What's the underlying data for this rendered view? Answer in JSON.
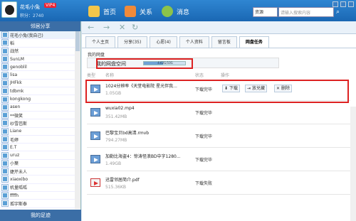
{
  "header": {
    "username": "花毛小兔",
    "vip_badge": "VIP4",
    "score": "积分：2740",
    "nav": [
      "首页",
      "关系",
      "消息"
    ],
    "search_select": "资源",
    "search_placeholder": "请输入搜索内容"
  },
  "sidebar": {
    "title": "邻居分享",
    "items": [
      "花毛小兔(我自己)",
      "稻",
      "战然",
      "SunLM",
      "genoblil",
      "lisa",
      "JHFkk",
      "tdbmk",
      "kongkong",
      "asen",
      "**微笑",
      "纱雪芭斯",
      "Liane",
      "毛婷",
      "E.T",
      "uruz",
      "小葉",
      "婕芹未人",
      "xiaoxibo",
      "机量呱呱",
      "ffffh",
      "孤宇斯泰"
    ],
    "footer": "我的足迹"
  },
  "tabs": [
    "个人主页",
    "分享(35)",
    "心愿(4)",
    "个人资料",
    "留言板",
    "网盘任务"
  ],
  "active_tab": "网盘任务",
  "section_title": "我的网盘",
  "space": {
    "label": "我的网盘空间",
    "usage": "4.62G/10G",
    "fraction": 0.46
  },
  "columns": [
    "类型",
    "名称",
    "状态",
    "操作"
  ],
  "files": [
    {
      "name": "1024分辨率《天堂电影院 星光伴我...",
      "size": "1.05GB",
      "status": "下载完毕",
      "type": "video"
    },
    {
      "name": "wuxia02.mp4",
      "size": "351.42MB",
      "status": "下载完毕",
      "type": "video"
    },
    {
      "name": "巴黎宝贝bd高清.rmvb",
      "size": "794.27MB",
      "status": "下载完毕",
      "type": "video"
    },
    {
      "name": "加勒比海盗4：惊涛怪浪BD中字1280...",
      "size": "1.49GB",
      "status": "下载完毕",
      "type": "video"
    },
    {
      "name": "迅雷邻居简介.pdf",
      "size": "515.36KB",
      "status": "下载失败",
      "type": "pdf"
    }
  ],
  "actions": {
    "download": "下载",
    "stash": "放兑藏",
    "delete": "删除"
  }
}
